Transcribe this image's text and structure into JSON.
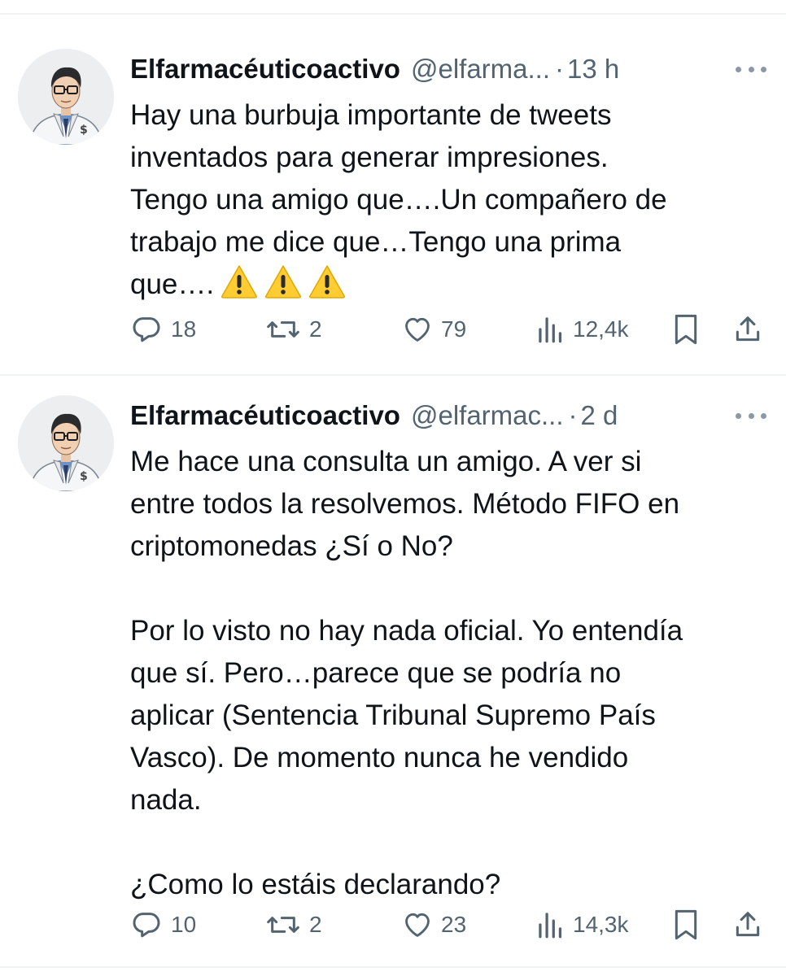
{
  "tweets": [
    {
      "name": "Elfarmacéuticoactivo",
      "handle": "@elfarma...",
      "separator": "·",
      "time": "13 h",
      "lines": [
        "Hay una burbuja importante de tweets",
        "inventados para generar impresiones.",
        "Tengo una amigo que….Un compañero de",
        "trabajo me dice que…Tengo una prima",
        "que…."
      ],
      "emoji": [
        "warning-emoji",
        "warning-emoji",
        "warning-emoji"
      ],
      "replies": "18",
      "reposts": "2",
      "likes": "79",
      "views": "12,4k"
    },
    {
      "name": "Elfarmacéuticoactivo",
      "handle": "@elfarmac...",
      "separator": "·",
      "time": "2 d",
      "lines": [
        "Me hace una consulta un amigo. A ver si",
        "entre todos la resolvemos. Método FIFO en",
        "criptomonedas ¿Sí o No?",
        "",
        "Por lo visto no hay nada oficial. Yo entendía",
        "que sí. Pero…parece que se podría no",
        "aplicar (Sentencia Tribunal Supremo País",
        "Vasco). De momento nunca he vendido",
        "nada.",
        "",
        "¿Como lo estáis declarando?"
      ],
      "replies": "10",
      "reposts": "2",
      "likes": "23",
      "views": "14,3k"
    }
  ],
  "icons": {
    "reply": "reply-icon",
    "repost": "repost-icon",
    "like": "heart-icon",
    "views": "views-icon",
    "bookmark": "bookmark-icon",
    "share": "share-icon",
    "more": "more-icon"
  },
  "colors": {
    "text": "#0f1419",
    "secondary": "#536471",
    "divider": "#eff3f4",
    "warning": "#ffcc33"
  }
}
